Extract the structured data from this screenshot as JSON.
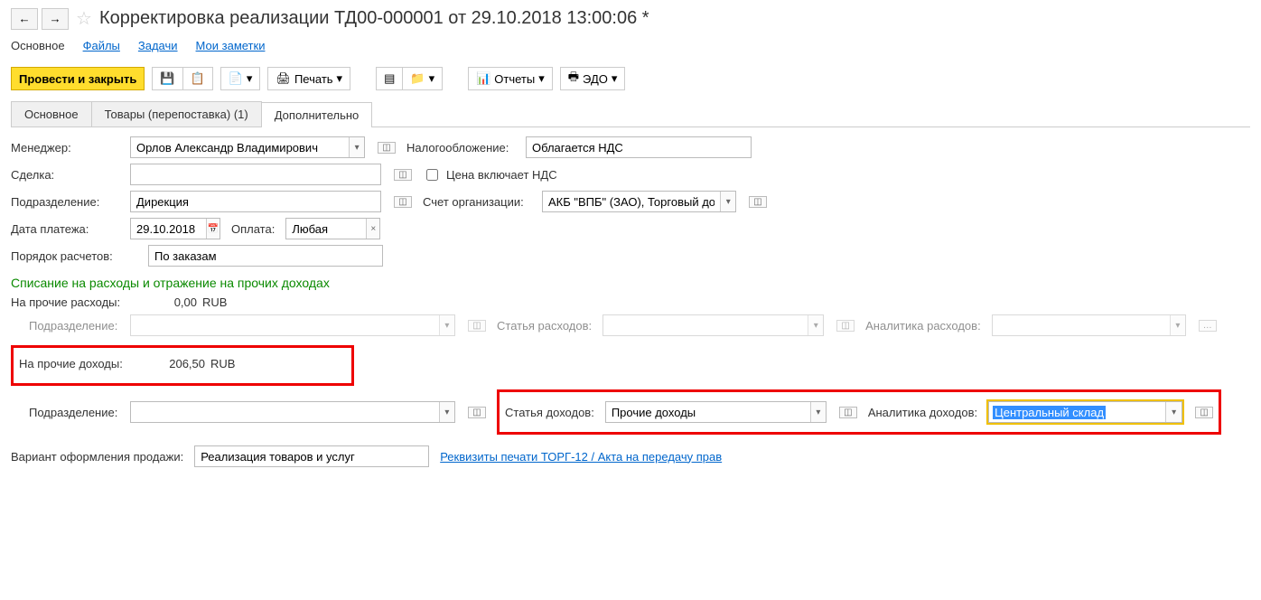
{
  "header": {
    "title": "Корректировка реализации ТД00-000001 от 29.10.2018 13:00:06 *"
  },
  "topnav": {
    "main": "Основное",
    "files": "Файлы",
    "tasks": "Задачи",
    "notes": "Мои заметки"
  },
  "toolbar": {
    "post_close": "Провести и закрыть",
    "print": "Печать",
    "reports": "Отчеты",
    "edo": "ЭДО"
  },
  "tabs": {
    "main": "Основное",
    "goods": "Товары (перепоставка) (1)",
    "extra": "Дополнительно"
  },
  "form": {
    "manager_label": "Менеджер:",
    "manager_value": "Орлов Александр Владимирович",
    "deal_label": "Сделка:",
    "deal_value": "",
    "dept_label": "Подразделение:",
    "dept_value": "Дирекция",
    "paydate_label": "Дата платежа:",
    "paydate_value": "29.10.2018",
    "payment_label": "Оплата:",
    "payment_value": "Любая",
    "order_label": "Порядок расчетов:",
    "order_value": "По заказам",
    "tax_label": "Налогообложение:",
    "tax_value": "Облагается НДС",
    "vat_incl_label": "Цена включает НДС",
    "account_label": "Счет организации:",
    "account_value": "АКБ \"ВПБ\" (ЗАО), Торговый дом \"К",
    "section_title": "Списание на расходы и отражение на прочих доходах",
    "other_exp_label": "На прочие расходы:",
    "other_exp_value": "0,00",
    "other_exp_cur": "RUB",
    "sub_dept_label": "Подразделение:",
    "exp_item_label": "Статья расходов:",
    "exp_analytics_label": "Аналитика расходов:",
    "other_inc_label": "На прочие доходы:",
    "other_inc_value": "206,50",
    "other_inc_cur": "RUB",
    "inc_item_label": "Статья доходов:",
    "inc_item_value": "Прочие доходы",
    "inc_analytics_label": "Аналитика доходов:",
    "inc_analytics_value": "Центральный склад",
    "variant_label": "Вариант оформления продажи:",
    "variant_value": "Реализация товаров и услуг",
    "requisites_link": "Реквизиты печати ТОРГ-12 / Акта на передачу прав"
  }
}
